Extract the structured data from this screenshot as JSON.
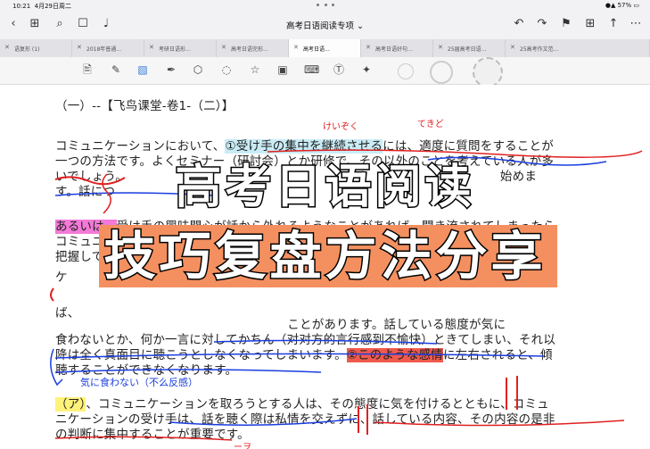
{
  "status_bar": {
    "time": "10:21",
    "date": "4月29日周二",
    "battery": "57%"
  },
  "nav": {
    "title": "高考日语阅读专项"
  },
  "tabs": [
    {
      "label": "语复形 (1)",
      "active": false
    },
    {
      "label": "2018年普通…",
      "active": false
    },
    {
      "label": "考研日语形…",
      "active": false
    },
    {
      "label": "高考日语完形…",
      "active": false
    },
    {
      "label": "高考日语…",
      "active": true
    },
    {
      "label": "高考日语好句…",
      "active": false
    },
    {
      "label": "25届高考日语…",
      "active": false
    },
    {
      "label": "25高考作文范…",
      "active": false
    }
  ],
  "document": {
    "heading": "（一）--【飞鸟课堂-卷1-（二）】",
    "lines": [
      {
        "pre": "コミュニケーションにおいて、",
        "hl": "①受け手の集中を継続させる",
        "post": "には、適度に質問をすることが"
      },
      {
        "text": "一つの方法です。よくセミナー（研討会）とか研修で、その以外のことを考えている人が多"
      },
      {
        "text": "いでしょう。　　　　　　　　　　　　　　　　　　　　　　　　　　　　　　　始めま"
      },
      {
        "text": "す。話につ"
      },
      {
        "pre": "",
        "hl": "あるいは、",
        "post": "受け手の興味関心が話から外れるようなことがあれば、聞き流されてしまったら"
      },
      {
        "text": "コミュニ"
      },
      {
        "text": "把握して"
      },
      {
        "text": "ケ"
      },
      {
        "text": ""
      },
      {
        "text": "ば、"
      },
      {
        "text": "　　　　　　　　　　　　　　　　　　　ことがあります。話している態度が気に"
      },
      {
        "text": "食わないとか、何か一言に対してかちん（对对方的言行感到不愉快）ときてしまい、それ以"
      },
      {
        "pre": "降は全く真面目に聴こうとしなくなってしまいます。",
        "hl": "②このような感情",
        "post": "に左右されると、傾"
      },
      {
        "text": "聴することができなくなります。"
      }
    ],
    "para2": [
      {
        "pre": "",
        "hl": "（ア）",
        "post": "、コミュニケーションを取ろうとする人は、その態度に気を付けるとともに、コミュ"
      },
      {
        "text": "ニケーションの受け手は、話を聴く際は私情を交えずに、話している内容、その内容の是非"
      },
      {
        "text": "の判断に集中することが重要です。"
      }
    ]
  },
  "overlay": {
    "line1": "高考日语阅读",
    "line2": "技巧复盘方法分享"
  },
  "annotations": {
    "furigana1": "けいぞく",
    "furigana2": "てきど",
    "blue_note": "気に食わない（不么反感）",
    "bottom_note": "ーヲ"
  },
  "colors": {
    "highlight_cyan": "#c9ecf6",
    "highlight_pink": "#f37ad8",
    "highlight_red": "#f05a4d",
    "highlight_yellow": "#fff27a",
    "orange_band": "#f49060",
    "pen_red": "#e02020",
    "pen_blue": "#1a3ee0"
  }
}
